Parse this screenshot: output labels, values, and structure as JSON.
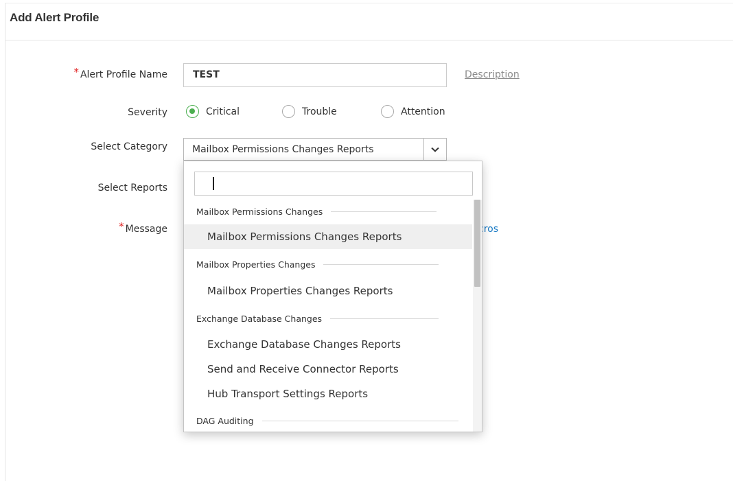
{
  "page": {
    "title": "Add Alert Profile"
  },
  "form": {
    "alert_profile_name": {
      "label": "Alert Profile Name",
      "value": "TEST",
      "required": true
    },
    "description_link": "Description",
    "severity": {
      "label": "Severity",
      "options": [
        {
          "label": "Critical",
          "selected": true
        },
        {
          "label": "Trouble",
          "selected": false
        },
        {
          "label": "Attention",
          "selected": false
        }
      ]
    },
    "category": {
      "label": "Select Category",
      "value": "Mailbox Permissions Changes Reports"
    },
    "reports": {
      "label": "Select Reports"
    },
    "message": {
      "label": "Message",
      "required": true,
      "macros_link_partial": "cros"
    }
  },
  "dropdown": {
    "search_value": "",
    "groups": [
      {
        "name": "Mailbox Permissions Changes",
        "items": [
          {
            "label": "Mailbox Permissions Changes Reports",
            "selected": true
          }
        ]
      },
      {
        "name": "Mailbox Properties Changes",
        "items": [
          {
            "label": "Mailbox Properties Changes Reports",
            "selected": false
          }
        ]
      },
      {
        "name": "Exchange Database Changes",
        "items": [
          {
            "label": "Exchange Database Changes Reports",
            "selected": false
          },
          {
            "label": "Send and Receive Connector Reports",
            "selected": false
          },
          {
            "label": "Hub Transport Settings Reports",
            "selected": false
          }
        ]
      },
      {
        "name": "DAG Auditing",
        "items": []
      }
    ]
  },
  "colors": {
    "required_marker": "#e02020",
    "radio_selected": "#4caf50",
    "link": "#1a7bc5",
    "selected_item_bg": "#efefef"
  }
}
